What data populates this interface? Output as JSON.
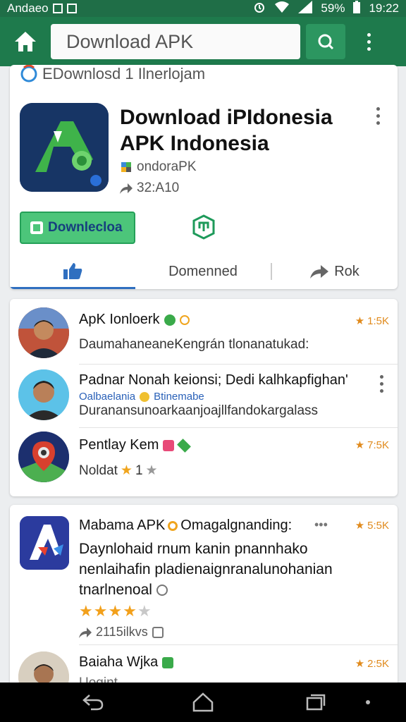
{
  "status_bar": {
    "carrier": "Andaeo",
    "battery": "59%",
    "time": "19:22"
  },
  "app_bar": {
    "search_text": "Download APK",
    "home_icon": "home-icon",
    "search_icon": "search-icon",
    "menu_icon": "more-vert-icon"
  },
  "featured": {
    "top_label": "EDownlosd 1 Ilnerlojam",
    "title": "Download iPIdonesia APK Indonesia",
    "developer": "ondoraPK",
    "stat": "32:A10",
    "download_label": "Downlecloa",
    "tabs": [
      {
        "label": ""
      },
      {
        "label": "Domenned"
      },
      {
        "label": "Rok"
      }
    ]
  },
  "list": [
    {
      "title": "ApK Ionloerk",
      "desc": "DaumahaneaneKengrán tlonanatukad:",
      "rating": "1:5K"
    },
    {
      "title": "Padnar Nonah keionsi; Dedi kalhkapfighan'",
      "sub_blue": "Oalbaelania",
      "sub_blue2": "Btinemabe",
      "desc": "Duranansunoarkaanjoajllfandokargalass"
    },
    {
      "title": "Pentlay Kem",
      "desc": "Noldat",
      "desc_stars": "1",
      "rating": "7:5K"
    }
  ],
  "app_card": {
    "title": "Mabama APK",
    "title_accent": "Omagalgnanding:",
    "more": "•••",
    "rating": "5:5K",
    "desc": "Daynlohaid rnum kanin pnannhako nenlaihafin pladienaignranalunohanian tnarlnenoal",
    "stars": 4,
    "stat": "2115ilkvs",
    "next_title": "Baiaha Wjka",
    "next_rating": "2:5K",
    "next_sub": "Uogint"
  },
  "colors": {
    "status_bar": "#1f6e47",
    "app_bar": "#1e7a4c",
    "search_button": "#2c9660",
    "download_button": "#4cc57a",
    "tab_indicator": "#2f6fc0",
    "rating_star": "#e08a1c"
  }
}
